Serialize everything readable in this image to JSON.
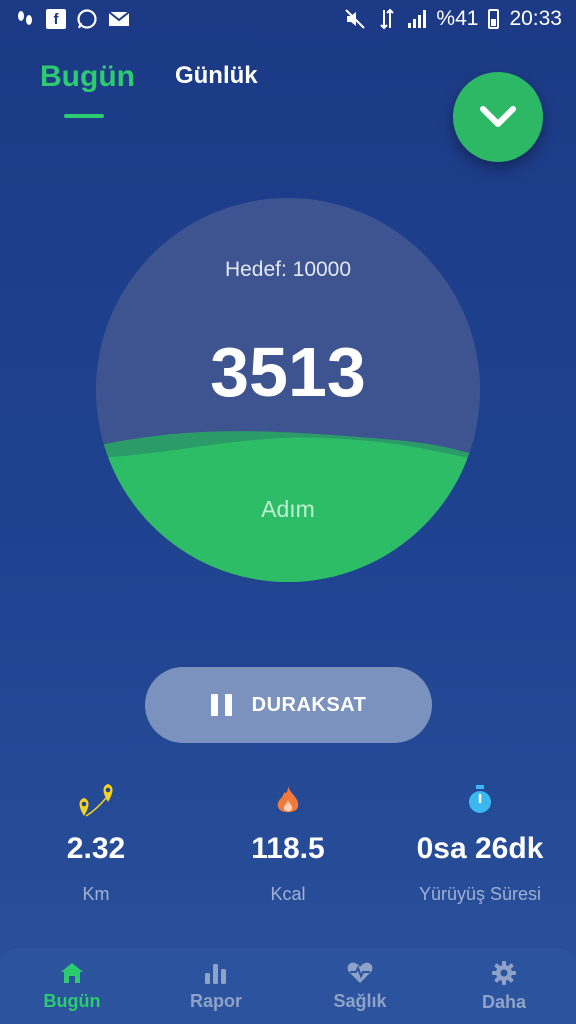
{
  "status_bar": {
    "left_icons": [
      "footsteps-icon",
      "facebook-icon",
      "whatsapp-icon",
      "mail-icon"
    ],
    "right_icons": [
      "mute-icon",
      "data-icon",
      "signal-icon",
      "battery-icon"
    ],
    "battery": "%41",
    "time": "20:33"
  },
  "tabs": [
    {
      "label": "Bugün",
      "active": true
    },
    {
      "label": "Günlük",
      "active": false
    }
  ],
  "progress": {
    "goal_text": "Hedef: 10000",
    "steps": "3513",
    "unit": "Adım",
    "fraction": 0.3513
  },
  "pause_button": {
    "label": "DURAKSAT",
    "icon": "pause-icon"
  },
  "stats": [
    {
      "icon": "route-pin-icon",
      "value": "2.32",
      "label": "Km",
      "color": "#f4d21f"
    },
    {
      "icon": "flame-icon",
      "value": "118.5",
      "label": "Kcal",
      "color": "#f07a3c"
    },
    {
      "icon": "stopwatch-icon",
      "value": "0sa 26dk",
      "label": "Yürüyüş Süresi",
      "color": "#3cb8f0"
    }
  ],
  "nav": [
    {
      "label": "Bugün",
      "icon": "home-icon",
      "active": true
    },
    {
      "label": "Rapor",
      "icon": "bar-chart-icon",
      "active": false
    },
    {
      "label": "Sağlık",
      "icon": "heart-pulse-icon",
      "active": false
    },
    {
      "label": "Daha",
      "icon": "gear-icon",
      "active": false
    }
  ],
  "colors": {
    "accent": "#2dcb6f",
    "background": "#1f4390"
  }
}
